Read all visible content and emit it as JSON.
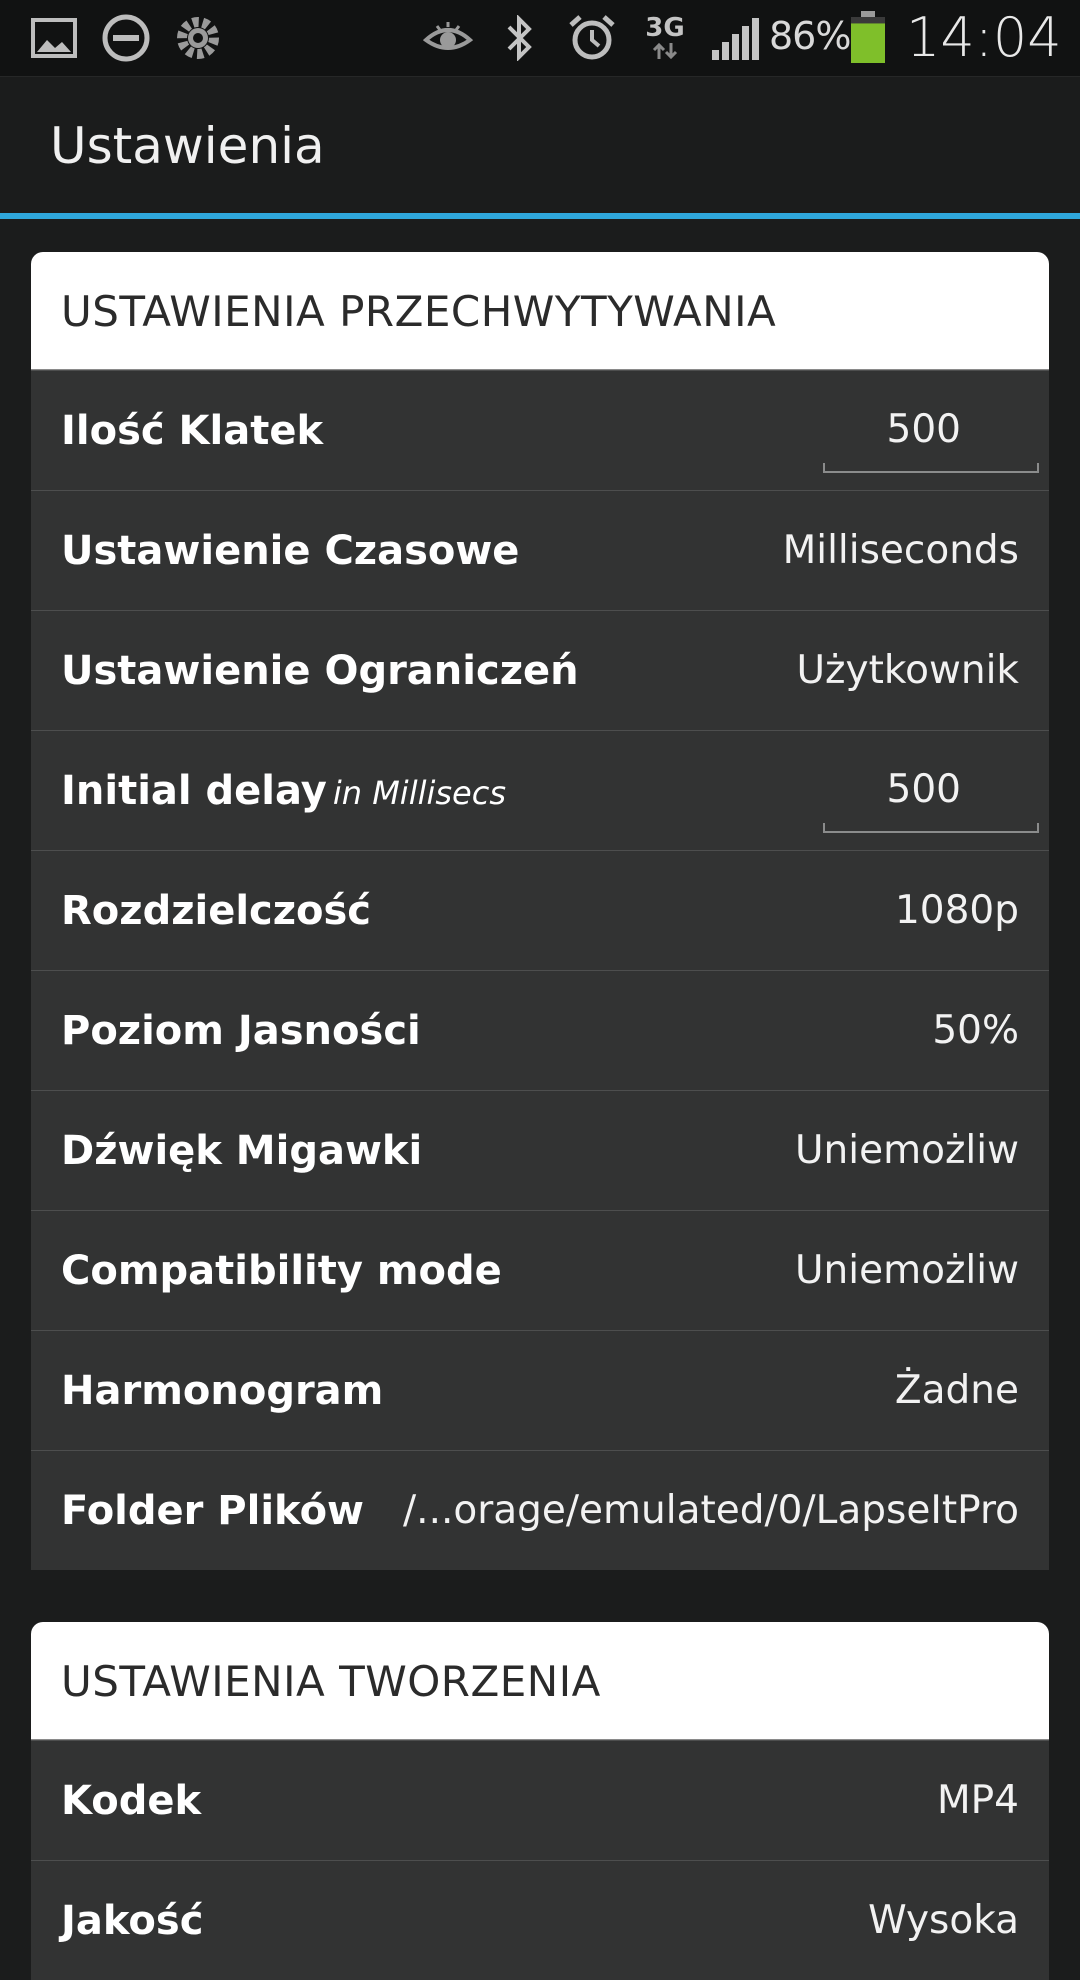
{
  "status_bar": {
    "icons": [
      "gallery-icon",
      "do-not-disturb-icon",
      "settings-gear-icon",
      "eye-icon",
      "bluetooth-icon",
      "alarm-icon",
      "network-3g-icon",
      "signal-icon",
      "battery-icon"
    ],
    "network_label": "3G",
    "battery_percent": "86%",
    "battery_level": 0.86,
    "time": "14:04",
    "battery_color": "#7fbf2a"
  },
  "action_bar": {
    "title": "Ustawienia",
    "accent_color": "#2fa7dc"
  },
  "capture_section": {
    "header": "USTAWIENIA PRZECHWYTYWANIA",
    "rows": [
      {
        "label": "Ilość Klatek",
        "value": "500"
      },
      {
        "label": "Ustawienie Czasowe",
        "value": "Milliseconds"
      },
      {
        "label": "Ustawienie Ograniczeń",
        "value": "Użytkownik"
      },
      {
        "label": "Initial delay",
        "sublabel": "in Millisecs",
        "value": "500"
      },
      {
        "label": "Rozdzielczość",
        "value": "1080p"
      },
      {
        "label": "Poziom Jasności",
        "value": "50%"
      },
      {
        "label": "Dźwięk Migawki",
        "value": "Uniemożliw"
      },
      {
        "label": "Compatibility mode",
        "value": "Uniemożliw"
      },
      {
        "label": "Harmonogram",
        "value": "Żadne"
      },
      {
        "label": "Folder Plików",
        "value": "/...orage/emulated/0/LapseItPro"
      }
    ]
  },
  "render_section": {
    "header": "USTAWIENIA TWORZENIA",
    "rows": [
      {
        "label": "Kodek",
        "value": "MP4"
      },
      {
        "label": "Jakość",
        "value": "Wysoka"
      }
    ]
  }
}
